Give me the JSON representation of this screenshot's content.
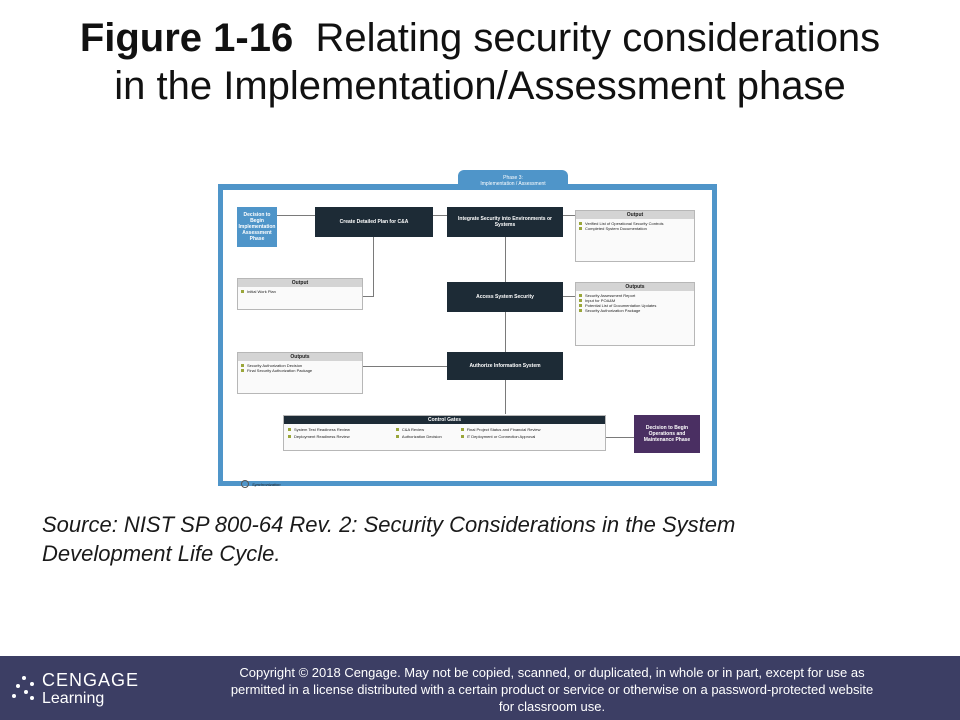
{
  "title": {
    "fig": "Figure 1-16",
    "text_line1": "Relating security considerations",
    "text_line2": "in the Implementation/Assessment phase"
  },
  "diagram": {
    "phase_tab": [
      "Phase 3:",
      "Implementation / Assessment"
    ],
    "start_box": "Decision to Begin Implementation Assessment Phase",
    "end_box": "Decision to Begin Operations and Maintenance Phase",
    "steps": [
      "Create Detailed Plan for C&A",
      "Integrate Security into Environments or Systems",
      "Access System Security",
      "Authorize Information System"
    ],
    "out1": {
      "header": "Output",
      "items": [
        "Initial Work Plan"
      ]
    },
    "out2": {
      "header": "Output",
      "items": [
        "Verified List of Operational Security Controls",
        "Completed System Documentation"
      ]
    },
    "out3": {
      "header": "Outputs",
      "items": [
        "Security Assessment Report",
        "Input for POA&M",
        "Potential List of Documentation Updates",
        "Security Authorization Package"
      ]
    },
    "out4": {
      "header": "Outputs",
      "items": [
        "Security Authorization Decision",
        "Final Security Authorization Package"
      ]
    },
    "gates": {
      "header": "Control Gates",
      "items": [
        "System Test Readiness Review",
        "C&A Review",
        "Final Project Status and Financial Review",
        "Deployment Readiness Review",
        "Authorization Decision",
        "IT Deployment or Connection Approval"
      ]
    },
    "sync_label": "Synchronization"
  },
  "source": {
    "line1": "Source: NIST SP 800-64 Rev. 2: Security Considerations in the System",
    "line2": "Development Life Cycle."
  },
  "footer": {
    "logo_top": "CENGAGE",
    "logo_bottom": "Learning",
    "copyright_line1": "Copyright © 2018 Cengage. May not be copied, scanned, or duplicated, in whole or in part, except for use as",
    "copyright_line2": "permitted in a license distributed with a certain product or service or otherwise on a password-protected website",
    "copyright_line3": "for classroom use."
  },
  "colors": {
    "frame": "#4f95c9",
    "dark_box": "#1d2b36",
    "end_box": "#4a2f62",
    "footer": "#3c3e64",
    "bullet": "#9aa63a"
  }
}
